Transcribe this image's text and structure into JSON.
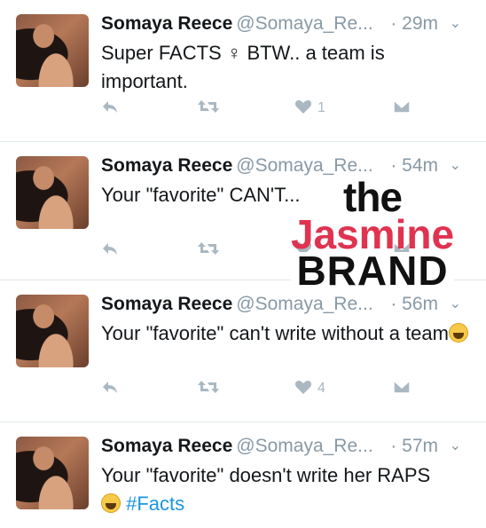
{
  "tweets": [
    {
      "name": "Somaya Reece",
      "handle": "@Somaya_Re...",
      "time": "· 29m",
      "text": "Super FACTS ♀ BTW.. a team is important.",
      "like_count": "1"
    },
    {
      "name": "Somaya Reece",
      "handle": "@Somaya_Re...",
      "time": "· 54m",
      "text": "Your \"favorite\" CAN'T...",
      "like_count": ""
    },
    {
      "name": "Somaya Reece",
      "handle": "@Somaya_Re...",
      "time": "· 56m",
      "text": "Your \"favorite\" can't write without a team",
      "like_count": "4"
    },
    {
      "name": "Somaya Reece",
      "handle": "@Somaya_Re...",
      "time": "· 57m",
      "text": "Your \"favorite\" doesn't write her RAPS",
      "hashtag": "#Facts"
    }
  ],
  "watermark": {
    "line1": "the",
    "line2": "Jasmine",
    "line3": "BRAND"
  },
  "colors": {
    "link": "#1b95e0",
    "muted": "#8899a6",
    "icon": "#aab8c2",
    "watermark_accent": "#e0334f"
  }
}
